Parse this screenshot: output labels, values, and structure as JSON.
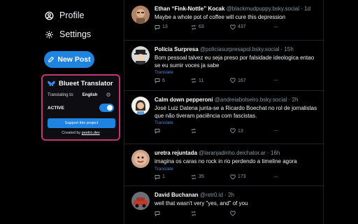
{
  "nav": {
    "profile_label": "Profile",
    "settings_label": "Settings",
    "new_post_label": "New Post"
  },
  "translator": {
    "title": "Blueet Translator",
    "translating_label": "Translating to:",
    "language": "English",
    "active_label": "ACTIVE",
    "active": true,
    "support_label": "Support this project",
    "credit_prefix": "Created by",
    "credit_link": "peetro.dev"
  },
  "posts": [
    {
      "name": "Ethan “Fink-Nottle” Kocak",
      "handle": "@blackmudpuppy.bsky.social",
      "time": "· 1d",
      "text": "Maybe a whole pot of coffee will cure this depression",
      "translate": "",
      "replies": "13",
      "reposts": "63",
      "likes": "437",
      "avatar_icon": "man-avatar-icon"
    },
    {
      "name": "Polícia Surpresa",
      "handle": "@policiasurpresapol.bsky.social",
      "time": "· 15h",
      "text": "Bom pessoal talvez eu seja preso por falsidade ideologica entao se eu sumir voces ja sabe",
      "translate": "Translate",
      "replies": "6",
      "reposts": "11",
      "likes": "167",
      "avatar_icon": "police-avatar-icon"
    },
    {
      "name": "Calm down pepperoni",
      "handle": "@andreiabolseiro.bsky.social",
      "time": "· 2h",
      "text": "José Luiz Datena junta-se a Ricardo Boechat no rol de jornalistas que não tiveram paciência com fascistas.",
      "translate": "Translate",
      "replies": "",
      "reposts": "",
      "likes": "13",
      "avatar_icon": "woman-avatar-icon"
    },
    {
      "name": "uretra rejuntada",
      "handle": "@laranjadinho.deichator.ar",
      "time": "· 16h",
      "text": "imagina os caras no rock in rio perdendo a timeline agora",
      "translate": "Translate",
      "replies": "1",
      "reposts": "35",
      "likes": "173",
      "avatar_icon": "face-avatar-icon"
    },
    {
      "name": "David Buchanan",
      "handle": "@retr0.id",
      "time": "· 2h",
      "text": "well that wasn't very \"yes, and\" of you",
      "translate": "",
      "replies": "",
      "reposts": "",
      "likes": "",
      "avatar_icon": "car-avatar-icon"
    }
  ],
  "colors": {
    "accent": "#1f83e0",
    "widget_border": "#c1376f",
    "link": "#2e8ff0",
    "muted": "#8b98a5"
  }
}
